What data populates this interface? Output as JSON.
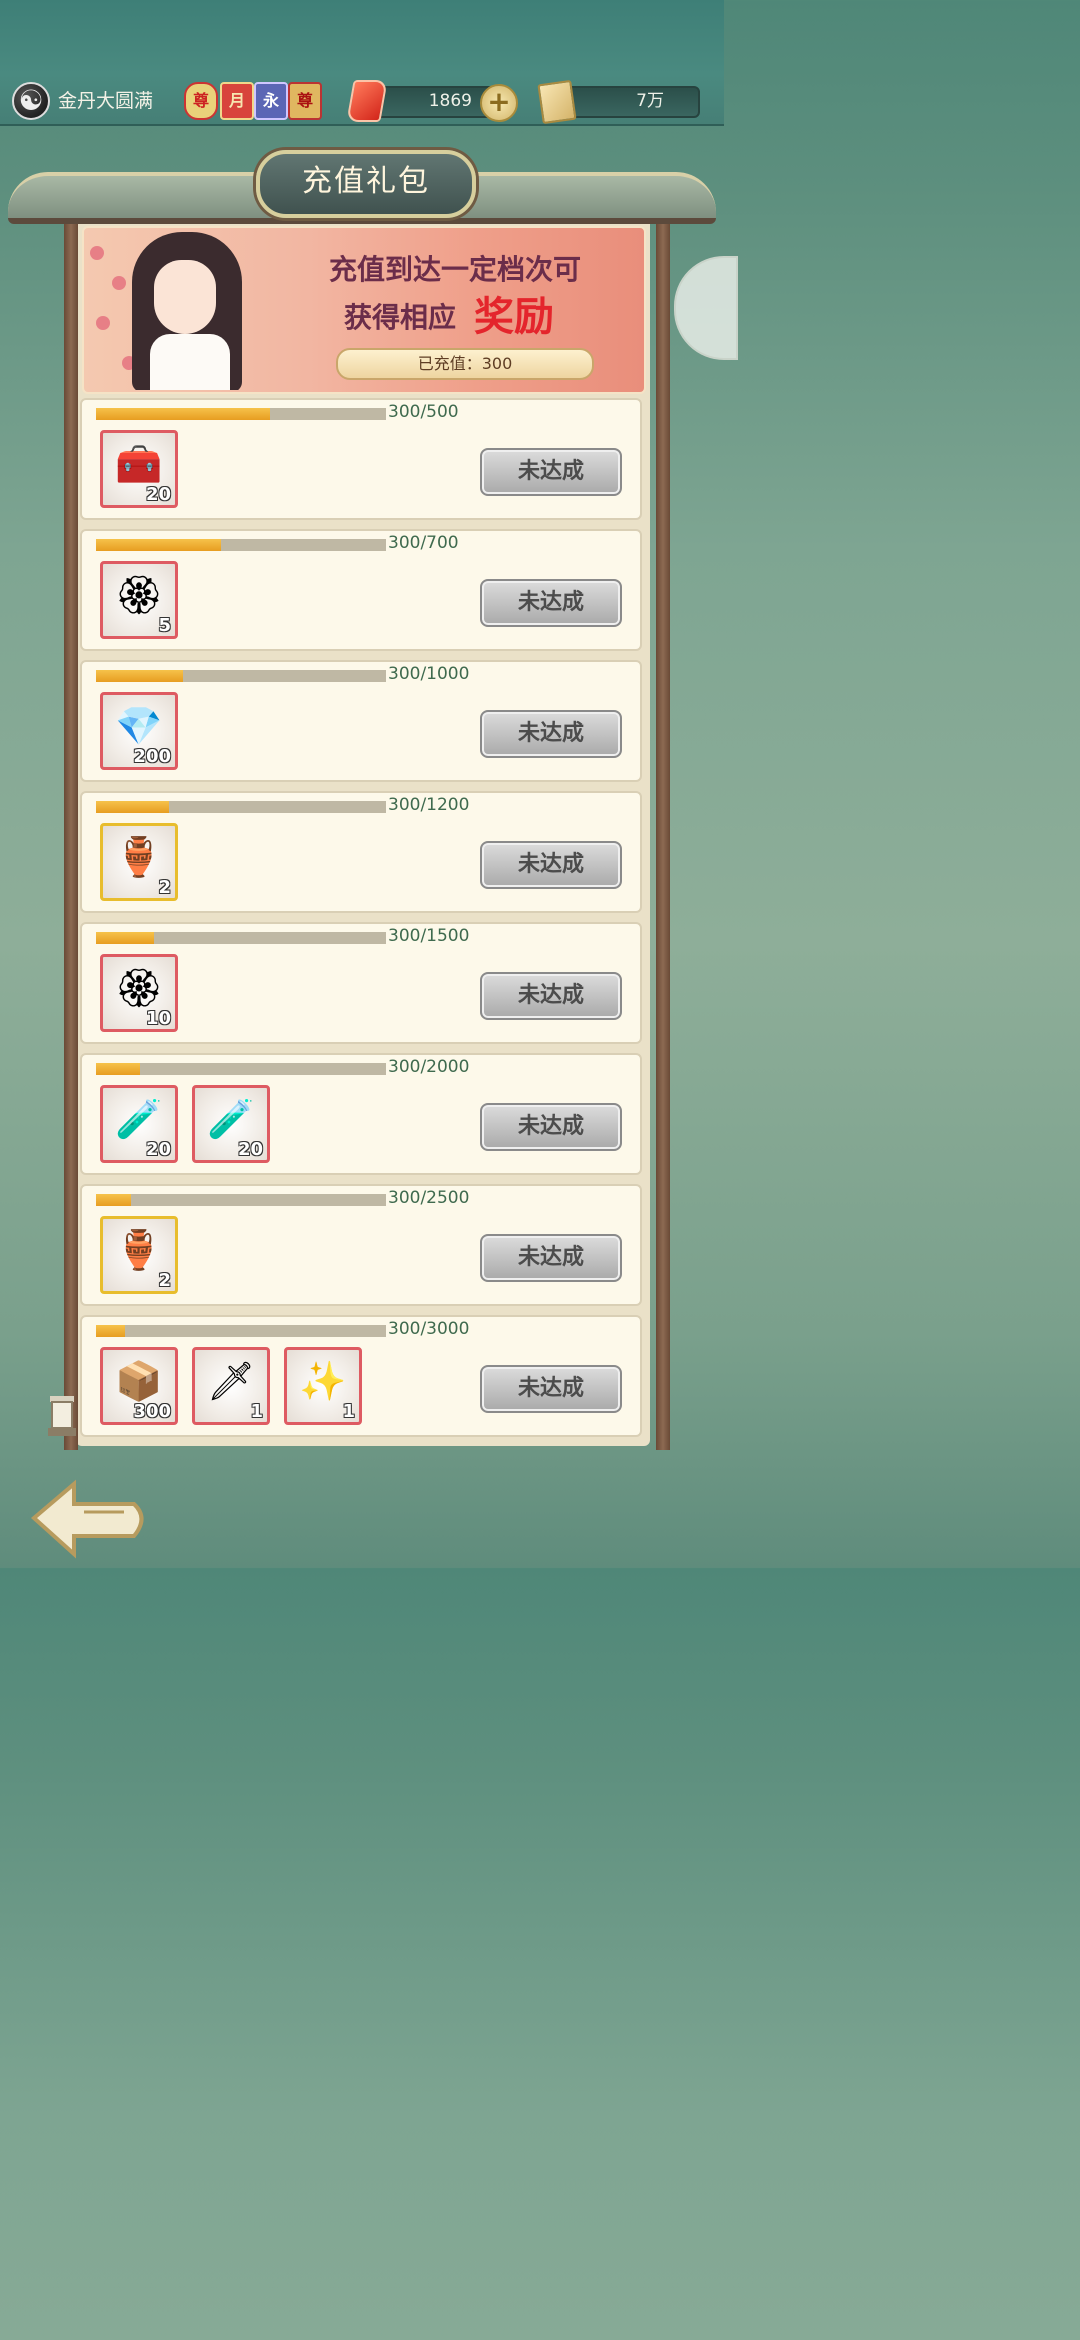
{
  "header": {
    "realm": "金丹大圆满",
    "badges": [
      "尊",
      "月",
      "永",
      "尊"
    ],
    "jade_amount": "1869",
    "silver_amount": "7万"
  },
  "title": "充值礼包",
  "banner": {
    "line1": "充值到达一定档次可",
    "line2a": "获得相应",
    "line2b": "奖励",
    "recharged": "已充值：300"
  },
  "status_label": "未达成",
  "tiers": [
    {
      "progress": "300/500",
      "fraction": 0.6,
      "items": [
        {
          "icon": "red-chest-icon",
          "count": "20",
          "frame": "red"
        }
      ]
    },
    {
      "progress": "300/700",
      "fraction": 0.43,
      "items": [
        {
          "icon": "jade-tray-icon",
          "count": "5",
          "frame": "red"
        }
      ]
    },
    {
      "progress": "300/1000",
      "fraction": 0.3,
      "items": [
        {
          "icon": "pink-crystal-icon",
          "count": "200",
          "frame": "red"
        }
      ]
    },
    {
      "progress": "300/1200",
      "fraction": 0.25,
      "items": [
        {
          "icon": "golden-cauldron-icon",
          "count": "2",
          "frame": "gold"
        }
      ]
    },
    {
      "progress": "300/1500",
      "fraction": 0.2,
      "items": [
        {
          "icon": "jade-tray-icon",
          "count": "10",
          "frame": "red"
        }
      ]
    },
    {
      "progress": "300/2000",
      "fraction": 0.15,
      "items": [
        {
          "icon": "orange-bottle-icon",
          "count": "20",
          "frame": "red"
        },
        {
          "icon": "blue-bottle-icon",
          "count": "20",
          "frame": "red"
        }
      ]
    },
    {
      "progress": "300/2500",
      "fraction": 0.12,
      "items": [
        {
          "icon": "golden-cauldron-icon",
          "count": "2",
          "frame": "gold"
        }
      ]
    },
    {
      "progress": "300/3000",
      "fraction": 0.1,
      "items": [
        {
          "icon": "mystery-box-icon",
          "count": "300",
          "frame": "red"
        },
        {
          "icon": "sword-icon",
          "count": "1",
          "frame": "red"
        },
        {
          "icon": "golden-aura-icon",
          "count": "1",
          "frame": "red"
        }
      ]
    }
  ]
}
